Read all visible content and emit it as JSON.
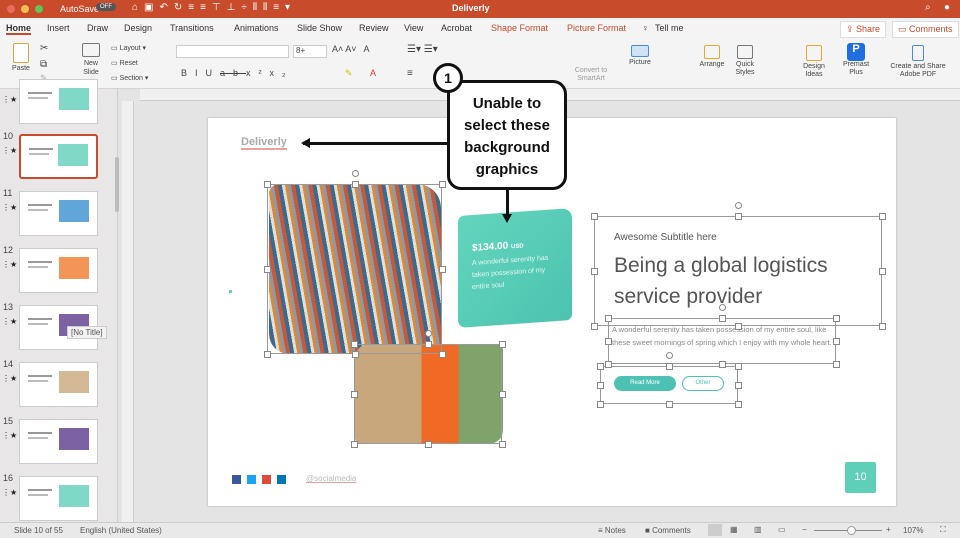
{
  "titlebar": {
    "autosave": "AutoSave",
    "toggle": "OFF",
    "title": "Deliverly",
    "color": "#c84b2b"
  },
  "tabs": [
    {
      "label": "Home"
    },
    {
      "label": "Insert"
    },
    {
      "label": "Draw"
    },
    {
      "label": "Design"
    },
    {
      "label": "Transitions"
    },
    {
      "label": "Animations"
    },
    {
      "label": "Slide Show"
    },
    {
      "label": "Review"
    },
    {
      "label": "View"
    },
    {
      "label": "Acrobat"
    },
    {
      "label": "Shape Format"
    },
    {
      "label": "Picture Format"
    },
    {
      "label": "Tell me"
    }
  ],
  "share": "Share",
  "comments": "Comments",
  "ribbon": {
    "paste": "Paste",
    "new_slide": "New Slide",
    "layout": "Layout",
    "reset": "Reset",
    "section": "Section",
    "font_size": "8+",
    "smartart": "Convert to SmartArt",
    "picture": "Picture",
    "arrange": "Arrange",
    "quick_styles": "Quick Styles",
    "design_ideas": "Design Ideas",
    "premast": "Premast Plus",
    "adobe": "Create and Share Adobe PDF"
  },
  "thumbs": [
    {
      "num": ""
    },
    {
      "num": "10"
    },
    {
      "num": "11"
    },
    {
      "num": "12"
    },
    {
      "num": "13"
    },
    {
      "num": "14"
    },
    {
      "num": "15"
    },
    {
      "num": "16"
    }
  ],
  "tooltip": "[No Title]",
  "slide": {
    "logo": "Deliverly",
    "price": "$134.00",
    "currency": "USD",
    "card_text": "A wonderful serenity has taken possession of my entire soul",
    "subtitle": "Awesome Subtitle here",
    "heading": "Being a global logistics service provider",
    "body": "A wonderful serenity has taken possession of my entire soul, like these sweet mornings of spring which I enjoy with my whole heart.",
    "read_more": "Read More",
    "other": "Other",
    "social": "@socialmedia",
    "page": "10",
    "accent": "#4fc9b5"
  },
  "callout": {
    "num": "1",
    "text": "Unable to select these background graphics"
  },
  "status": {
    "slide": "Slide 10 of 55",
    "lang": "English (United States)",
    "notes": "Notes",
    "comments": "Comments",
    "zoom": "107%",
    "zoom_level": 0.55
  }
}
